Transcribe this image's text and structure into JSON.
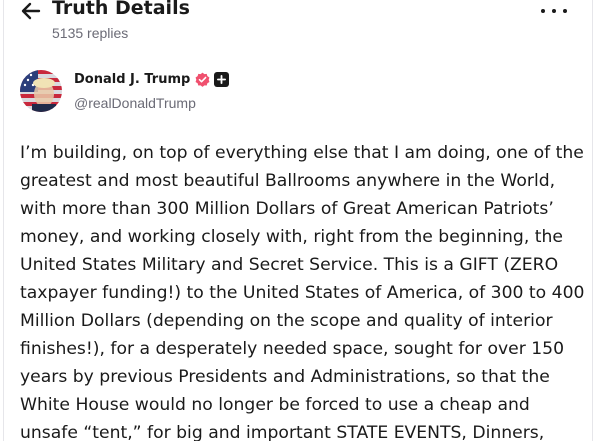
{
  "header": {
    "title": "Truth Details",
    "replies": "5135 replies",
    "back_icon": "arrow-left-icon",
    "more_icon": "more-horizontal-icon"
  },
  "author": {
    "display_name": "Donald J. Trump",
    "handle": "@realDonaldTrump",
    "verified_color": "#f0506e",
    "avatar_icon": "profile-avatar"
  },
  "post": {
    "lines": [
      "I’m building, on top of everything else that I am doing, one of the",
      "greatest and most beautiful Ballrooms anywhere in the World,",
      "with more than 300 Million Dollars of Great American Patriots’",
      "money, and working closely with, right from the beginning, the",
      "United States Military and Secret Service. This is a GIFT (ZERO",
      "taxpayer funding!) to the United States of America, of 300 to 400",
      "Million Dollars (depending on the scope and quality of interior",
      "finishes!), for a desperately needed space, sought for over 150",
      "years by previous Presidents and Administrations, so that the",
      "White House would no longer be forced to use a cheap and",
      "unsafe “tent,” for big and important STATE EVENTS, Dinners,"
    ]
  }
}
